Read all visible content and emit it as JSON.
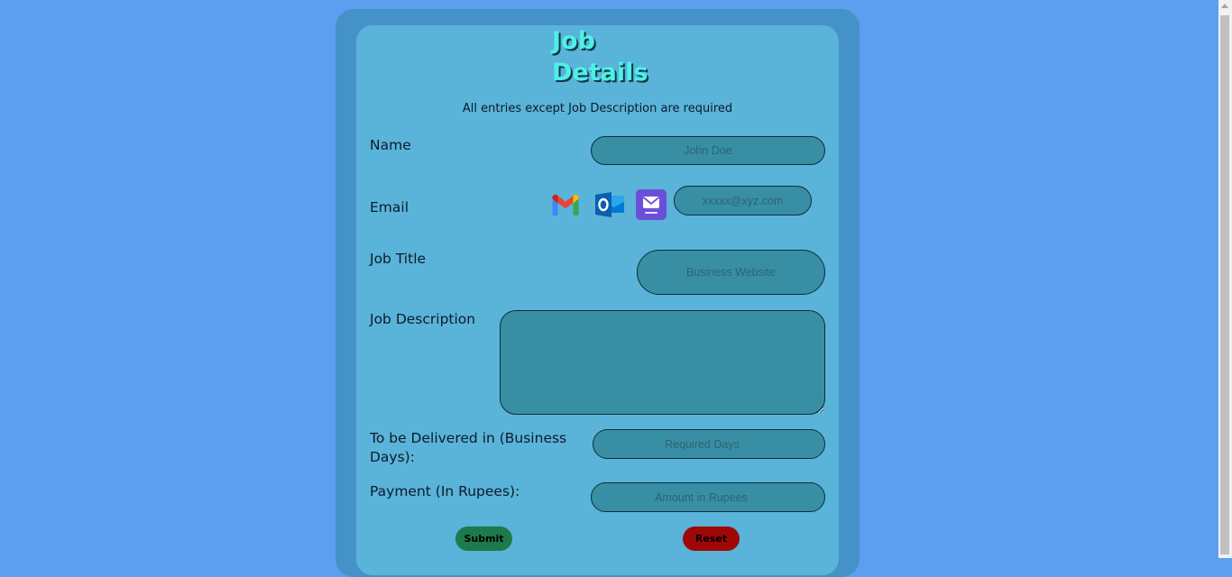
{
  "form": {
    "title": "Job Details",
    "note": "All entries except Job Description are required",
    "name": {
      "label": "Name",
      "placeholder": "John Doe"
    },
    "email": {
      "label": "Email",
      "placeholder": "xxxxx@xyz.com"
    },
    "job_title": {
      "label": "Job Title",
      "placeholder": "Business Website"
    },
    "job_description": {
      "label": "Job Description"
    },
    "delivery": {
      "label": "To be Delivered in (Business Days):",
      "placeholder": "Required Days"
    },
    "payment": {
      "label": "Payment (In Rupees):",
      "placeholder": "Amount in Rupees"
    },
    "submit_label": "Submit",
    "reset_label": "Reset"
  },
  "email_providers": [
    {
      "icon": "gmail-icon"
    },
    {
      "icon": "outlook-icon"
    },
    {
      "icon": "yahoo-mail-icon"
    }
  ],
  "colors": {
    "page_background": "#5c9ff0",
    "outer_panel": "#4592c8",
    "inner_panel": "#5ab3d8",
    "field": "#388fa3",
    "title": "#4ef0e6",
    "submit": "#1d7a4c",
    "reset": "#a00808"
  }
}
